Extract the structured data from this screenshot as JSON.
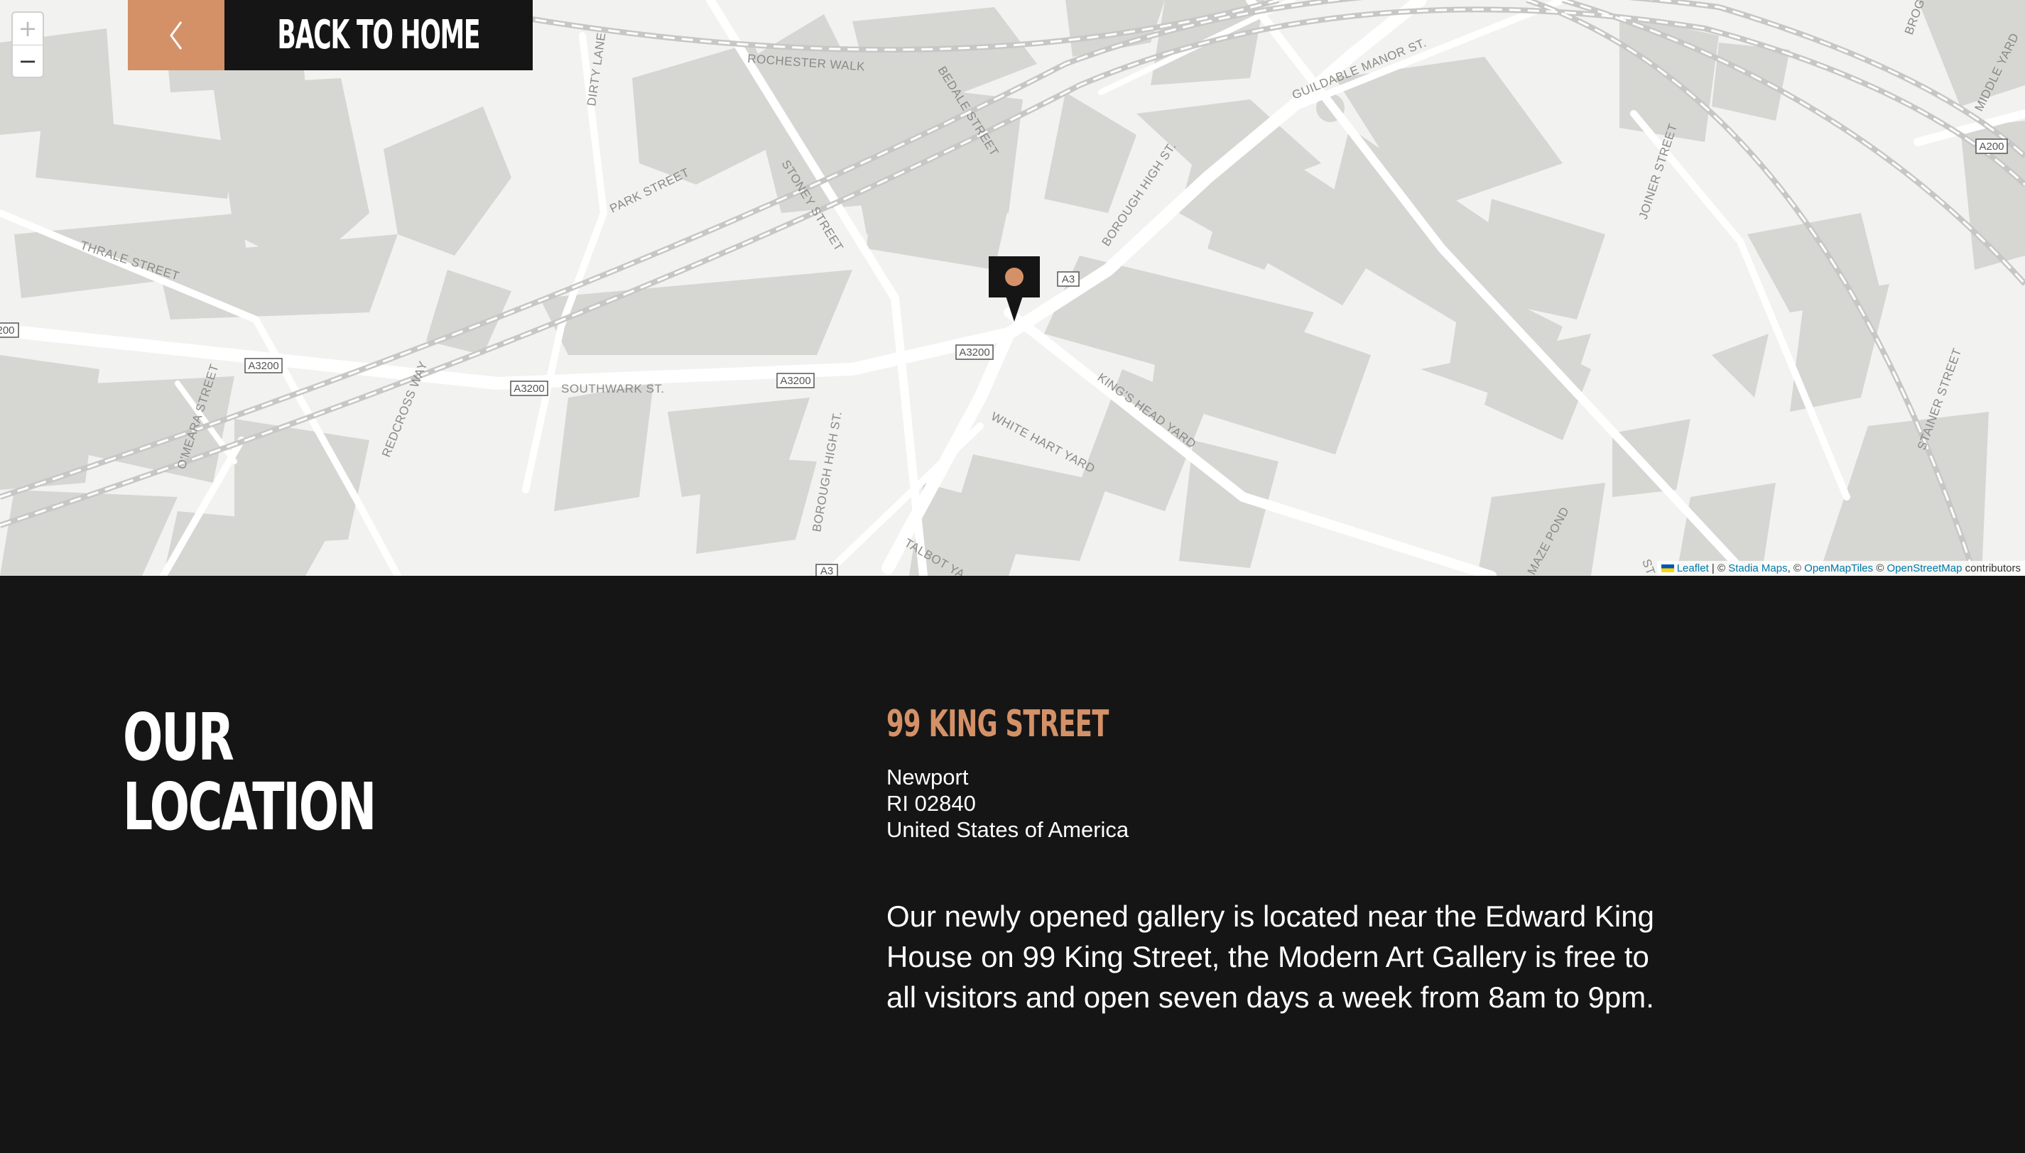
{
  "nav": {
    "back_label": "BACK TO HOME",
    "back_icon": "chevron-left-icon"
  },
  "map": {
    "zoom_in": "+",
    "zoom_out": "−",
    "street_labels": [
      "ROCHESTER WALK",
      "DIRTY LANE",
      "BEDALE STREET",
      "GUILDABLE MANOR ST.",
      "BOROUGH HIGH ST.",
      "JOINER STREET",
      "MIDDLE YARD",
      "BROGE",
      "PARK STREET",
      "STONEY STREET",
      "THRALE STREET",
      "SOUTHWARK ST.",
      "REDCROSS WAY",
      "O'MEARA STREET",
      "KING'S HEAD YARD",
      "WHITE HART YARD",
      "BOROUGH HIGH ST.",
      "TALBOT YA",
      "MAZE POND",
      "STAINER STREET",
      "ST"
    ],
    "road_shields": [
      "A3",
      "A3200",
      "A3200",
      "A3200",
      "A3200",
      "A3200",
      "A200",
      "A3",
      "200"
    ],
    "marker_icon": "map-pin-icon",
    "attribution": {
      "leaflet": "Leaflet",
      "sep1": " | © ",
      "stadia": "Stadia Maps",
      "sep2": ", © ",
      "omt": "OpenMapTiles",
      "sep3": " © ",
      "osm": "OpenStreetMap",
      "tail": " contributors"
    },
    "colors": {
      "land": "#f2f2f0",
      "building": "#d6d6d3",
      "road": "#ffffff",
      "rail": "#c4c4c2",
      "marker": "#151515",
      "marker_dot": "#d49167"
    }
  },
  "location": {
    "heading_line1": "OUR",
    "heading_line2": "LOCATION",
    "address_title": "99 KING STREET",
    "address_line1": "Newport",
    "address_line2": "RI 02840",
    "address_line3": "United States of America",
    "description": "Our newly opened gallery is located near the Edward King House on 99 King Street, the Modern Art Gallery is free to all visitors and open seven days a week from 8am to 9pm."
  },
  "colors": {
    "accent": "#d49167",
    "background": "#151515",
    "text": "#ffffff"
  }
}
